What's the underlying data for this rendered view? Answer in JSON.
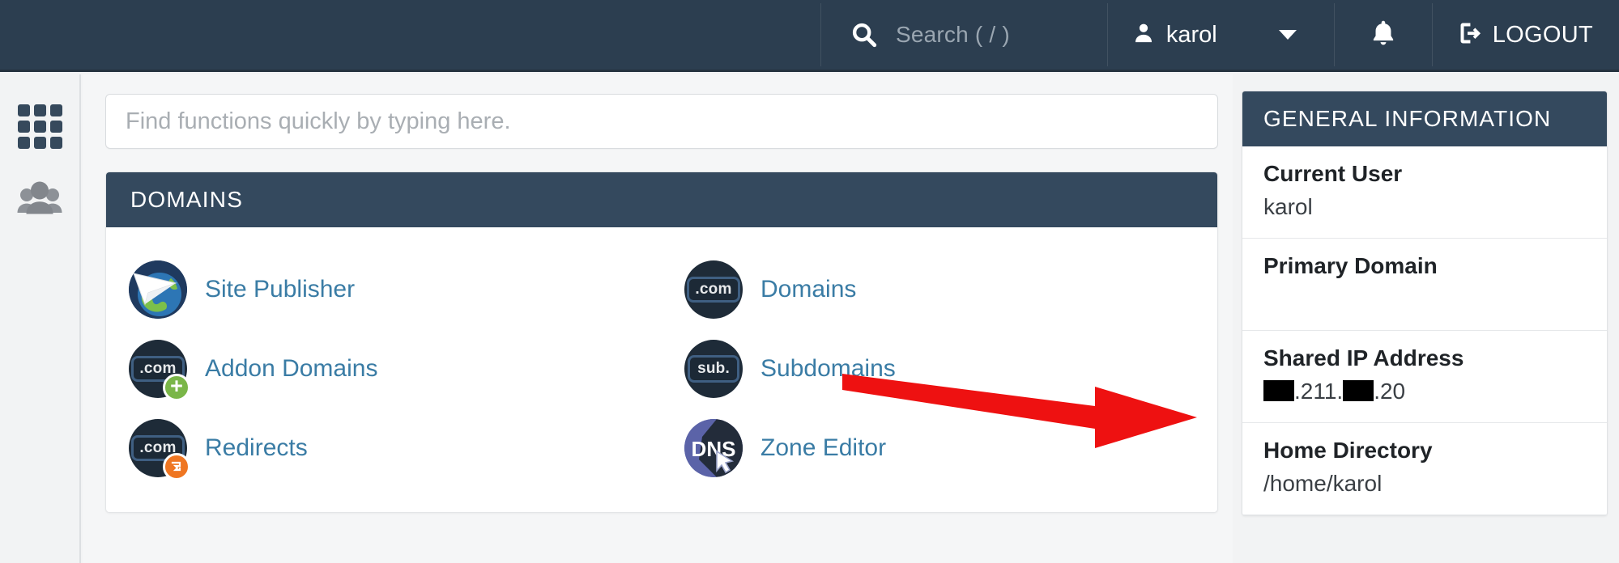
{
  "header": {
    "search_placeholder": "Search ( / )",
    "search_icon": "search-icon",
    "username": "karol",
    "user_icon": "person-icon",
    "caret_icon": "chevron-down-icon",
    "notifications_icon": "bell-icon",
    "logout_label": "LOGOUT",
    "logout_icon": "logout-icon",
    "accent_bg": "#2c3e50"
  },
  "sidebar": {
    "items": [
      {
        "name": "apps-grid",
        "icon": "grid-icon"
      },
      {
        "name": "user-manager",
        "icon": "people-icon"
      }
    ]
  },
  "quick_search": {
    "placeholder": "Find functions quickly by typing here.",
    "value": ""
  },
  "domains_panel": {
    "title": "DOMAINS",
    "minimize_label": "",
    "minimize_icon": "minimize-icon",
    "items": [
      {
        "label": "Site Publisher",
        "icon": "site-publisher-icon"
      },
      {
        "label": "Domains",
        "icon": "domains-com-icon",
        "badge_text": ".com"
      },
      {
        "label": "Addon Domains",
        "icon": "addon-domains-icon",
        "badge_text": ".com",
        "badge": "plus-badge"
      },
      {
        "label": "Subdomains",
        "icon": "subdomains-icon",
        "badge_text": "sub."
      },
      {
        "label": "Redirects",
        "icon": "redirects-icon",
        "badge_text": ".com",
        "badge": "redirect-badge"
      },
      {
        "label": "Zone Editor",
        "icon": "dns-zone-editor-icon",
        "badge_text": "DNS"
      }
    ]
  },
  "general_information": {
    "title": "GENERAL INFORMATION",
    "rows": [
      {
        "key": "Current User",
        "value": "karol",
        "redacted": false
      },
      {
        "key": "Primary Domain",
        "value": "",
        "redacted": false
      },
      {
        "key": "Shared IP Address",
        "value": ".211..20",
        "redacted": true,
        "parts": [
          ".211.",
          ".20"
        ]
      },
      {
        "key": "Home Directory",
        "value": "/home/karol",
        "redacted": false
      }
    ]
  },
  "annotation": {
    "type": "arrow",
    "color": "#ee1111",
    "direction": "right"
  },
  "colors": {
    "header_bg": "#2c3e50",
    "panel_header_bg": "#34495e",
    "link_blue": "#3a7ca5",
    "page_bg": "#f5f6f7",
    "annotation_red": "#ee1111"
  }
}
